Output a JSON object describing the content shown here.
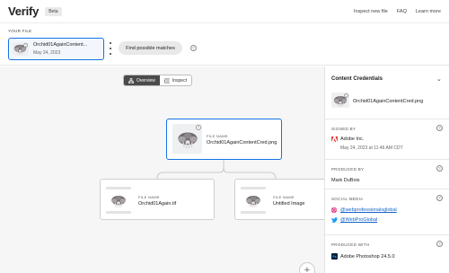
{
  "header": {
    "brand": "Verify",
    "beta": "Beta",
    "links": [
      "Inspect new file",
      "FAQ",
      "Learn more"
    ]
  },
  "your_file": {
    "section_label": "YOUR FILE",
    "name": "Orchid01AgainContent...",
    "date": "May 24, 2023",
    "find_button": "Find possible matches",
    "help": "?"
  },
  "view_toggle": {
    "overview": "Overview",
    "inspect": "Inspect"
  },
  "graph": {
    "main_node": {
      "label": "FILE NAME",
      "name": "Orchid01AgainContentCred.png"
    },
    "child_nodes": [
      {
        "label": "FILE NAME",
        "name": "Orchid01Again.tif"
      },
      {
        "label": "FILE NAME",
        "name": "Untitled Image"
      }
    ],
    "zoom_in": "+"
  },
  "panel": {
    "title": "Content Credentials",
    "file_name": "Orchid01AgainContentCred.png",
    "signed_by": {
      "label": "SIGNED BY",
      "issuer": "Adobe Inc.",
      "date": "May 24, 2023 at 11:46 AM CDT"
    },
    "produced_by": {
      "label": "PRODUCED BY",
      "name": "Mark DuBois"
    },
    "social_media": {
      "label": "SOCIAL MEDIA",
      "accounts": [
        "@webprofessionalsglobal",
        "@WebProGlobal"
      ]
    },
    "produced_with": {
      "label": "PRODUCED WITH",
      "app": "Adobe Photoshop 24.5.0"
    }
  },
  "colors": {
    "accent": "#1473e6",
    "adobe_red": "#e1251b",
    "instagram": "#dd2a7b",
    "twitter": "#1d9bf0",
    "photoshop": "#001e36"
  }
}
